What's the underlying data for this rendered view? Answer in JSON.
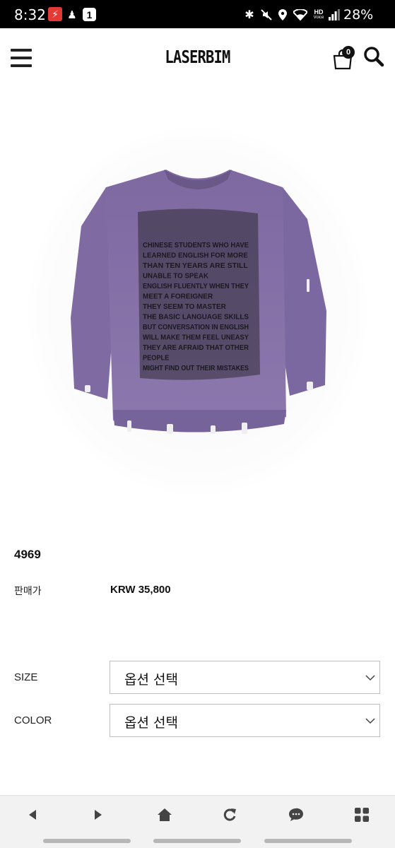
{
  "status_bar": {
    "time": "8:32",
    "app_badge": "1",
    "network": "HD",
    "network_sub": "Voice",
    "battery": "28%"
  },
  "header": {
    "logo": "LASERBIM",
    "cart_count": "0"
  },
  "product": {
    "name": "4969",
    "price_label": "판매가",
    "price": "KRW 35,800"
  },
  "options": [
    {
      "label": "SIZE",
      "selected": "옵션 선택"
    },
    {
      "label": "COLOR",
      "selected": "옵션 선택"
    }
  ],
  "sweater_text": [
    "CHINESE STUDENTS WHO HAVE",
    "LEARNED ENGLISH FOR MORE",
    "THAN TEN YEARS ARE STILL",
    "UNABLE TO SPEAK",
    "ENGLISH FLUENTLY WHEN THEY",
    "MEET A FOREIGNER",
    "THEY SEEM TO MASTER",
    "THE BASIC LANGUAGE SKILLS",
    "BUT CONVERSATION IN ENGLISH",
    "WILL MAKE THEM FEEL UNEASY",
    "THEY ARE AFRAID THAT OTHER",
    "PEOPLE",
    "MIGHT FIND OUT THEIR MISTAKES"
  ],
  "bottom_nav": [
    "back-icon",
    "forward-icon",
    "home-icon",
    "refresh-icon",
    "chat-icon",
    "apps-icon"
  ],
  "colors": {
    "sweater": "#8a76a8",
    "sweater_dark": "#6c5a8c",
    "accent": "#111111",
    "flash_badge": "#e53935"
  }
}
